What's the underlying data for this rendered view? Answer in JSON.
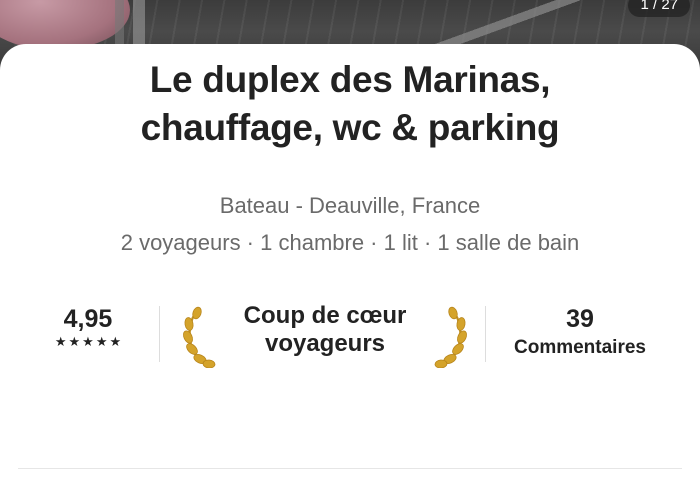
{
  "photo": {
    "counter": "1 / 27"
  },
  "listing": {
    "title_line1": "Le duplex des Marinas,",
    "title_line2": "chauffage, wc & parking",
    "location": "Bateau - Deauville, France",
    "details": "2 voyageurs · 1 chambre · 1 lit · 1 salle de bain"
  },
  "stats": {
    "rating_value": "4,95",
    "rating_stars": 5,
    "favorite_line1": "Coup de cœur",
    "favorite_line2": "voyageurs",
    "reviews_count": "39",
    "reviews_label": "Commentaires"
  },
  "icons": {
    "laurel_left": "laurel-left-icon",
    "laurel_right": "laurel-right-icon",
    "star": "star-icon"
  },
  "colors": {
    "laurel": "#d4a32b",
    "text": "#222222",
    "muted": "#6a6a6a"
  }
}
